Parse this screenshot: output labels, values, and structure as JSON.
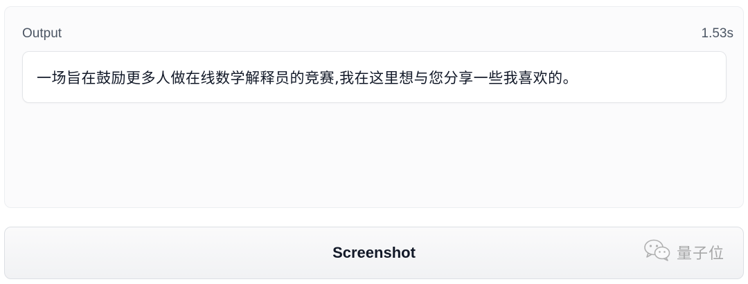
{
  "output": {
    "label": "Output",
    "time": "1.53s",
    "text": "一场旨在鼓励更多人做在线数学解释员的竞赛,我在这里想与您分享一些我喜欢的。"
  },
  "actions": {
    "screenshot_label": "Screenshot"
  },
  "watermark": {
    "icon": "wechat-icon",
    "text": "量子位"
  }
}
